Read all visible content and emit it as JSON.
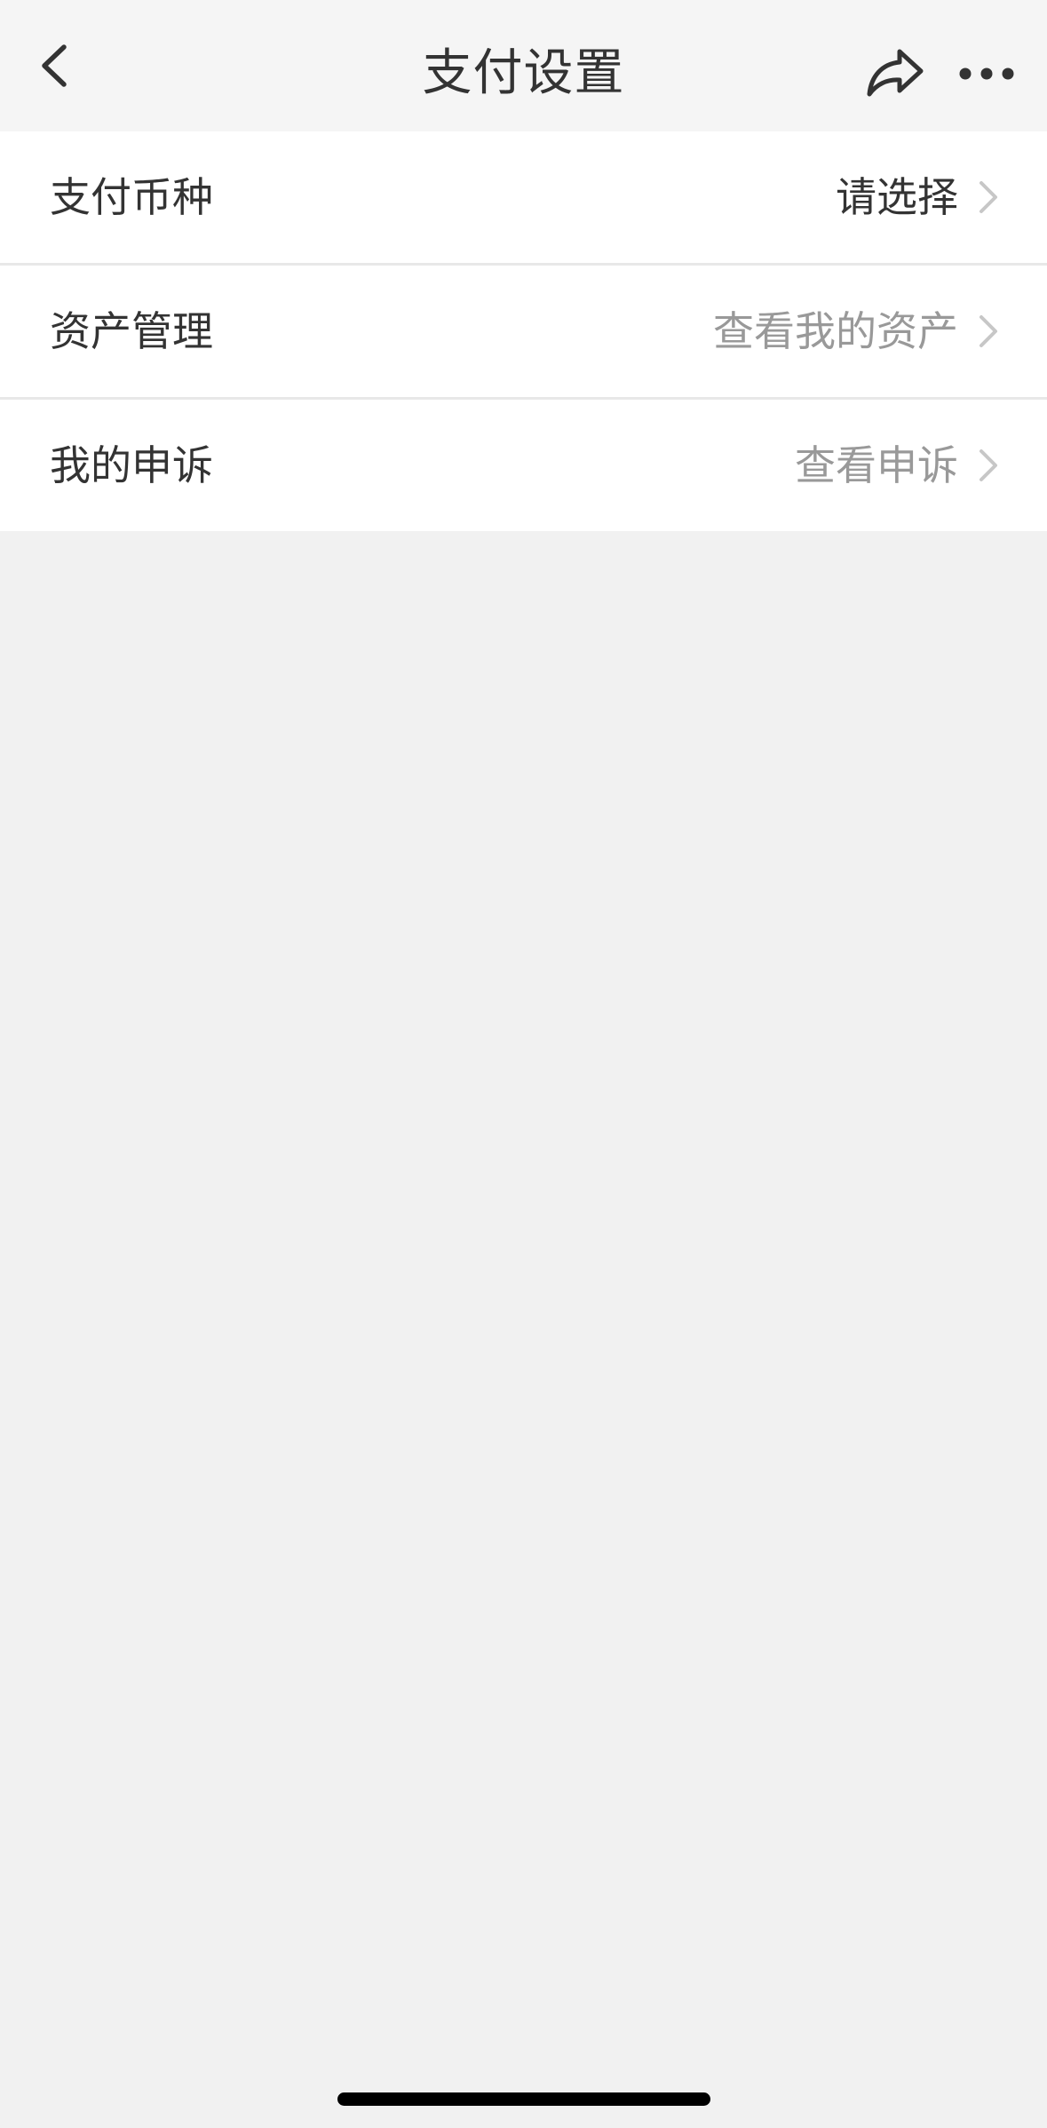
{
  "header": {
    "title": "支付设置",
    "icons": {
      "back": "back-chevron-icon",
      "share": "share-icon",
      "more": "more-dots-icon"
    }
  },
  "settings": {
    "items": [
      {
        "label": "支付币种",
        "value": "请选择"
      },
      {
        "label": "资产管理",
        "value": "查看我的资产"
      },
      {
        "label": "我的申诉",
        "value": "查看申诉"
      }
    ]
  },
  "colors": {
    "background": "#f1f1f1",
    "header_background": "#f5f5f5",
    "row_background": "#ffffff",
    "primary_text": "#333333",
    "secondary_text": "#999999",
    "chevron": "#c7c7c7"
  }
}
